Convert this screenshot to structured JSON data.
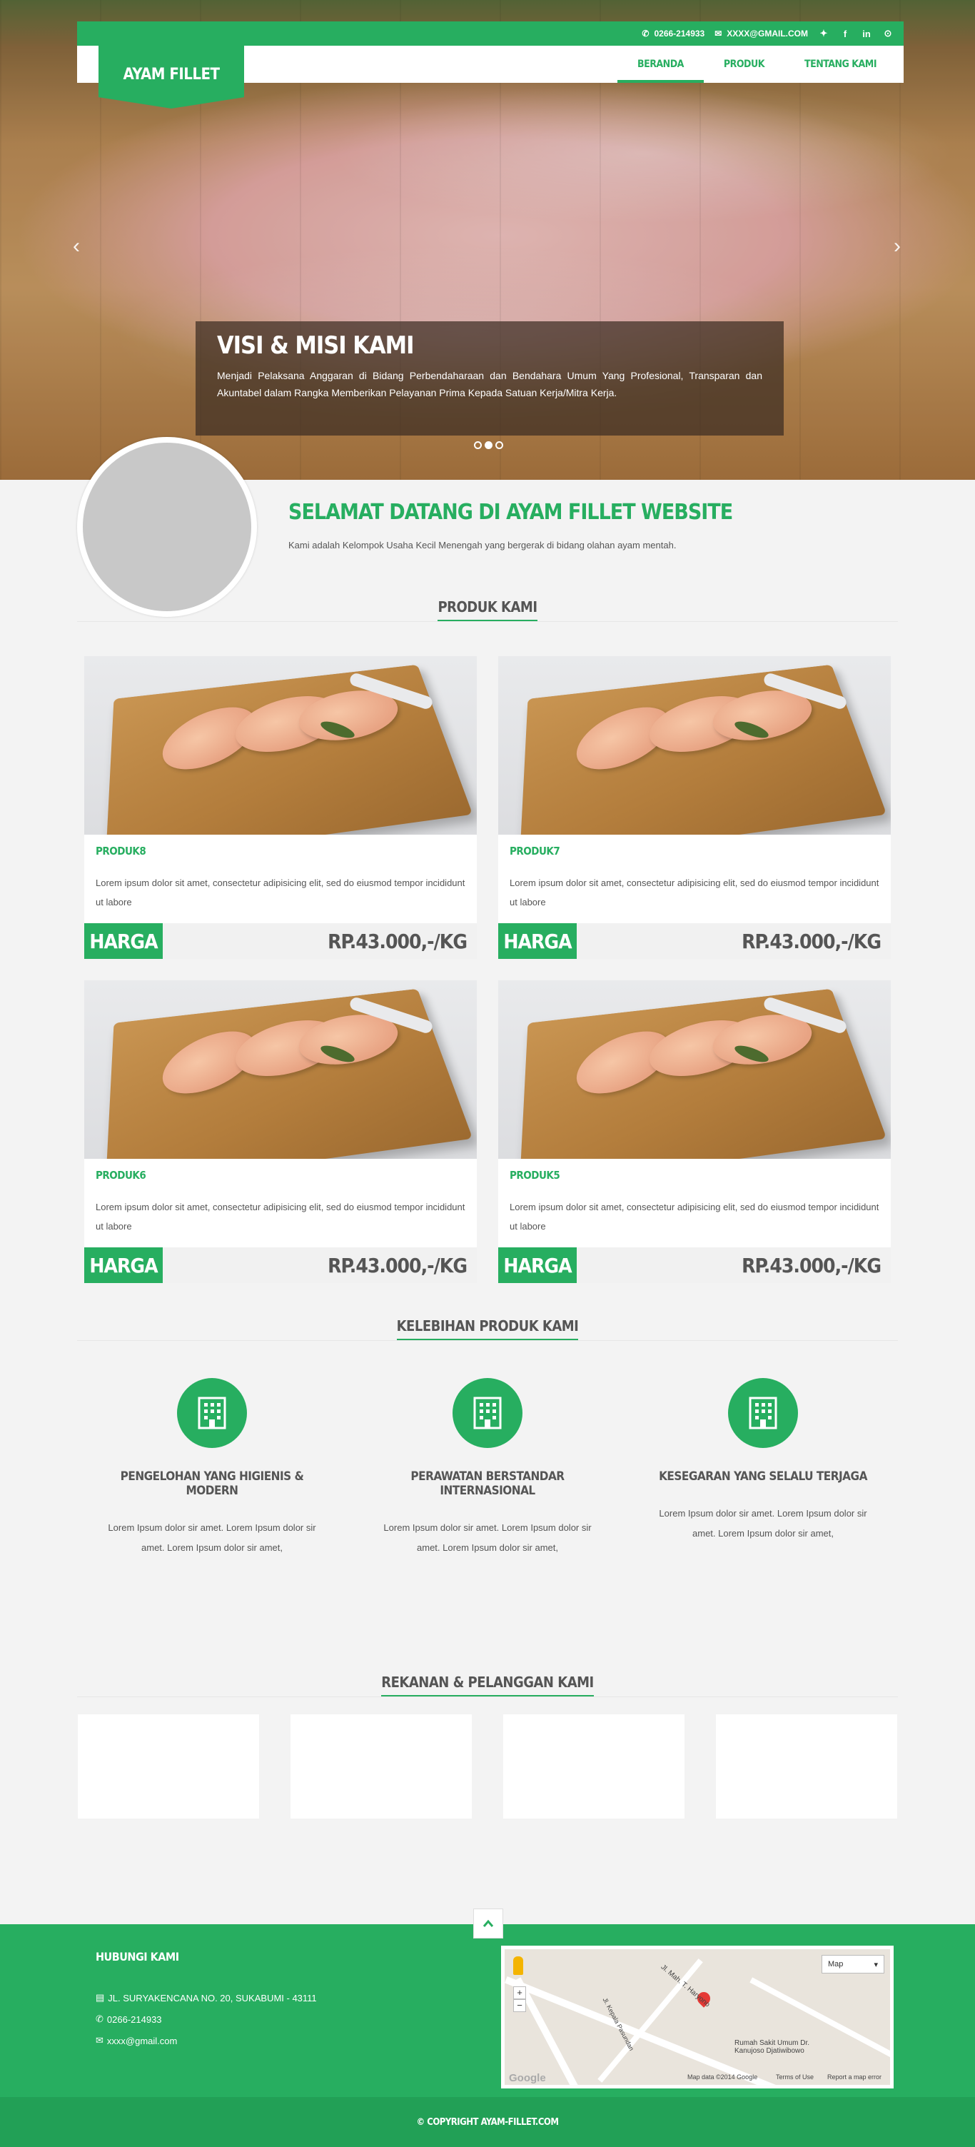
{
  "topbar": {
    "phone": "0266-214933",
    "email": "XXXX@GMAIL.COM",
    "social": [
      "twitter-icon",
      "facebook-icon",
      "linkedin-icon",
      "map-pin-icon"
    ]
  },
  "logo": "AYAM FILLET",
  "nav": [
    {
      "label": "BERANDA",
      "active": true
    },
    {
      "label": "PRODUK",
      "active": false
    },
    {
      "label": "TENTANG KAMI",
      "active": false
    }
  ],
  "slider": {
    "title": "VISI & MISI KAMI",
    "text": "Menjadi Pelaksana Anggaran di Bidang Perbendaharaan dan Bendahara Umum Yang Profesional, Transparan dan Akuntabel dalam Rangka Memberikan Pelayanan Prima Kepada Satuan Kerja/Mitra Kerja.",
    "prev_arrow": "‹",
    "next_arrow": "›",
    "slides": 3,
    "active_slide": 2
  },
  "welcome": {
    "title": "SELAMAT DATANG DI AYAM FILLET WEBSITE",
    "text": "Kami adalah Kelompok Usaha Kecil Menengah yang bergerak di bidang olahan ayam mentah."
  },
  "products_section": {
    "title": "PRODUK KAMI",
    "items": [
      {
        "name": "PRODUK8",
        "desc": "Lorem ipsum dolor sit amet, consectetur adipisicing elit, sed do eiusmod tempor incididunt ut labore",
        "harga_label": "HARGA",
        "price": "RP.43.000,-/KG"
      },
      {
        "name": "PRODUK7",
        "desc": "Lorem ipsum dolor sit amet, consectetur adipisicing elit, sed do eiusmod tempor incididunt ut labore",
        "harga_label": "HARGA",
        "price": "RP.43.000,-/KG"
      },
      {
        "name": "PRODUK6",
        "desc": "Lorem ipsum dolor sit amet, consectetur adipisicing elit, sed do eiusmod tempor incididunt ut labore",
        "harga_label": "HARGA",
        "price": "RP.43.000,-/KG"
      },
      {
        "name": "PRODUK5",
        "desc": "Lorem ipsum dolor sit amet, consectetur adipisicing elit, sed do eiusmod tempor incididunt ut labore",
        "harga_label": "HARGA",
        "price": "RP.43.000,-/KG"
      }
    ]
  },
  "features_section": {
    "title": "KELEBIHAN PRODUK KAMI",
    "items": [
      {
        "icon": "building-icon",
        "title": "PENGELOHAN YANG HIGIENIS & MODERN",
        "text": "Lorem Ipsum dolor sir amet. Lorem Ipsum dolor sir amet. Lorem Ipsum dolor sir amet,"
      },
      {
        "icon": "building-icon",
        "title": "PERAWATAN BERSTANDAR INTERNASIONAL",
        "text": "Lorem Ipsum dolor sir amet. Lorem Ipsum dolor sir amet. Lorem Ipsum dolor sir amet,"
      },
      {
        "icon": "building-icon",
        "title": "KESEGARAN YANG SELALU TERJAGA",
        "text": "Lorem Ipsum dolor sir amet. Lorem Ipsum dolor sir amet. Lorem Ipsum dolor sir amet,"
      }
    ]
  },
  "partners_section": {
    "title": "REKANAN & PELANGGAN KAMI",
    "count": 4
  },
  "footer": {
    "contact_title": "HUBUNGI KAMI",
    "address": "JL. SURYAKENCANA NO. 20, SUKABUMI - 43111",
    "phone": "0266-214933",
    "email": "xxxx@gmail.com",
    "map": {
      "type_label": "Map",
      "zoom_in": "+",
      "zoom_out": "−",
      "road1": "Jl. Mah. T. Haryono",
      "road2": "Jl. Kepala Pasundan",
      "place": "Rumah Sakit Umum Dr. Kanujoso Djatiwibowo",
      "google": "Google",
      "attribution": "Map data ©2014 Google",
      "terms": "Terms of Use",
      "report": "Report a map error"
    },
    "copyright": "© COPYRIGHT AYAM-FILLET.COM"
  },
  "colors": {
    "accent": "#27ae60",
    "background": "#f3f3f3",
    "text": "#555555"
  }
}
